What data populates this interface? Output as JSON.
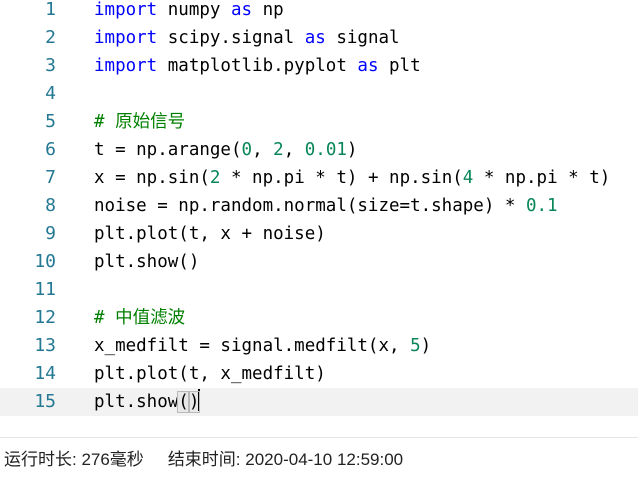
{
  "editor": {
    "lines": [
      {
        "n": "1",
        "t": "import numpy as np"
      },
      {
        "n": "2",
        "t": "import scipy.signal as signal"
      },
      {
        "n": "3",
        "t": "import matplotlib.pyplot as plt"
      },
      {
        "n": "4",
        "t": ""
      },
      {
        "n": "5",
        "t": "# 原始信号"
      },
      {
        "n": "6",
        "t": "t = np.arange(0, 2, 0.01)"
      },
      {
        "n": "7",
        "t": "x = np.sin(2 * np.pi * t) + np.sin(4 * np.pi * t)"
      },
      {
        "n": "8",
        "t": "noise = np.random.normal(size=t.shape) * 0.1"
      },
      {
        "n": "9",
        "t": "plt.plot(t, x + noise)"
      },
      {
        "n": "10",
        "t": "plt.show()"
      },
      {
        "n": "11",
        "t": ""
      },
      {
        "n": "12",
        "t": "# 中值滤波"
      },
      {
        "n": "13",
        "t": "x_medfilt = signal.medfilt(x, 5)"
      },
      {
        "n": "14",
        "t": "plt.plot(t, x_medfilt)"
      },
      {
        "n": "15",
        "t": "plt.show()"
      }
    ],
    "active_line": "15"
  },
  "status": {
    "runtime": "运行时长: 276毫秒",
    "end_time": "结束时间: 2020-04-10 12:59:00"
  },
  "colors": {
    "keyword": "#0000ff",
    "number": "#098658",
    "comment": "#008000",
    "line_number": "#237893"
  }
}
